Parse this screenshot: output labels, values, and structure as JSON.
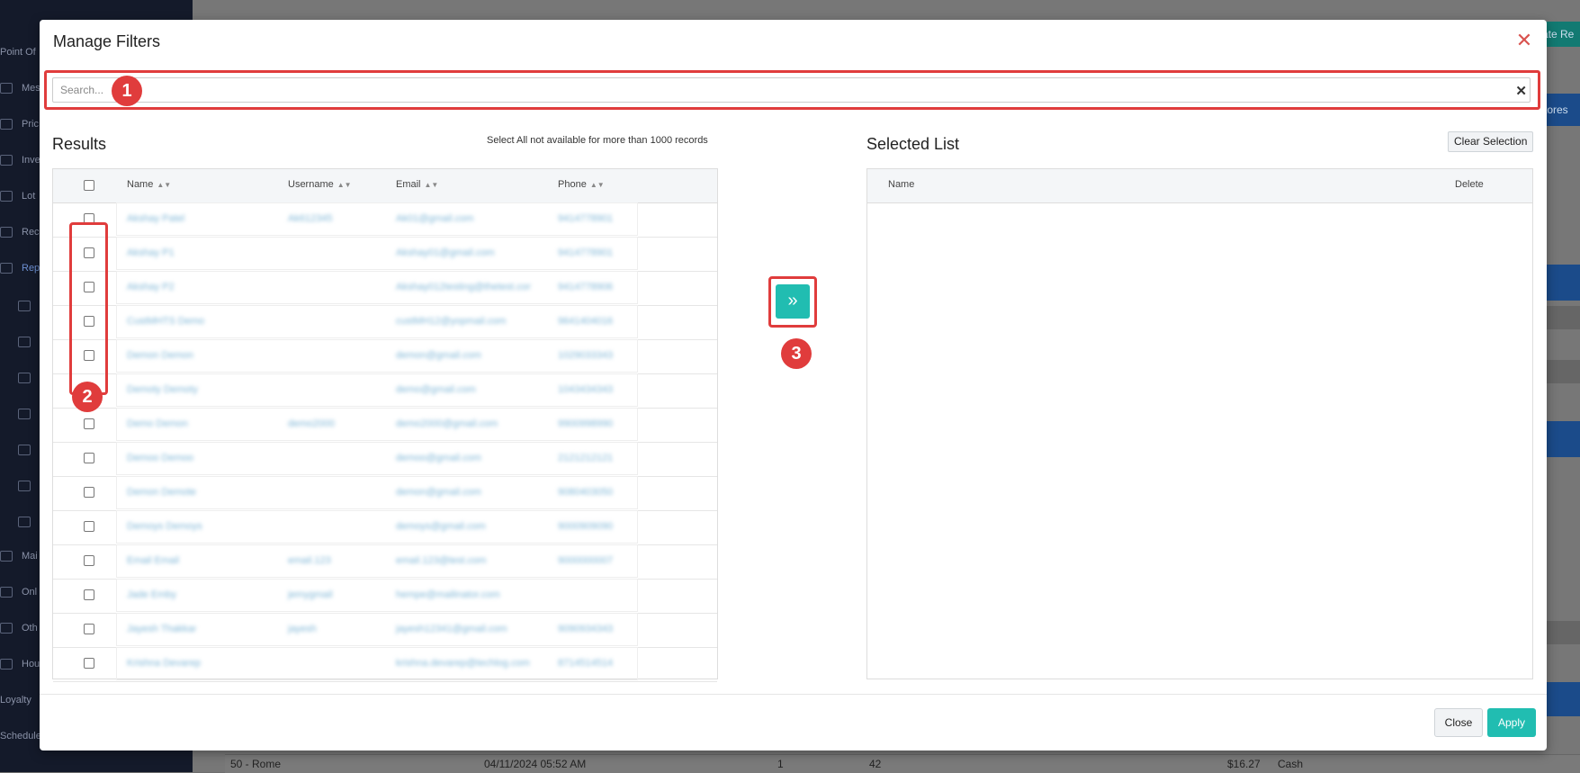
{
  "background": {
    "sidebar_items": [
      {
        "label": "Point Of",
        "icon": "none"
      },
      {
        "label": "Mes",
        "icon": "message-icon"
      },
      {
        "label": "Pric",
        "icon": "tag-icon"
      },
      {
        "label": "Inve",
        "icon": "inventory-icon"
      },
      {
        "label": "Lot",
        "icon": "lot-icon"
      },
      {
        "label": "Rec",
        "icon": "grid-icon"
      },
      {
        "label": "Rep",
        "icon": "chart-icon"
      },
      {
        "label": "Mai",
        "icon": "wrench-icon"
      },
      {
        "label": "Onl",
        "icon": "bag-icon"
      },
      {
        "label": "Oth",
        "icon": "gears-icon"
      },
      {
        "label": "Hou",
        "icon": "house-icon"
      },
      {
        "label": "Loyalty",
        "icon": "none"
      },
      {
        "label": "Schedule",
        "icon": "none"
      }
    ],
    "top_right_button": "ate Re",
    "right_bar_label": "tores",
    "bottom_row": {
      "store": "50 - Rome",
      "datetime": "04/11/2024 05:52 AM",
      "qty": "1",
      "num": "42",
      "amount": "$16.27",
      "payment": "Cash"
    }
  },
  "modal": {
    "title": "Manage Filters",
    "search": {
      "placeholder": "Search...",
      "value": ""
    },
    "callouts": [
      "1",
      "2",
      "3"
    ],
    "results": {
      "title": "Results",
      "note": "Select All not available for more than 1000 records",
      "columns": [
        "Name",
        "Username",
        "Email",
        "Phone"
      ],
      "rows": [
        {
          "name": "Akshay Patel",
          "username": "Ak612345",
          "email": "Ak01@gmail.com",
          "phone": "9414778901"
        },
        {
          "name": "Akshay P1",
          "username": "",
          "email": "Akshay01@gmail.com",
          "phone": "9414778901"
        },
        {
          "name": "Akshay P2",
          "username": "",
          "email": "Akshay012testing@thetest.com",
          "phone": "9414778906"
        },
        {
          "name": "CustMHTS Demo",
          "username": "",
          "email": "custMH12@yopmail.com",
          "phone": "9641404016"
        },
        {
          "name": "Demon Demon",
          "username": "",
          "email": "demon@gmail.com",
          "phone": "1029033343"
        },
        {
          "name": "Demoty Demoty",
          "username": "",
          "email": "demo@gmail.com",
          "phone": "1043434343"
        },
        {
          "name": "Demo Demon",
          "username": "demo2000",
          "email": "demo2000@gmail.com",
          "phone": "9900998990"
        },
        {
          "name": "Demoo Demoo",
          "username": "",
          "email": "demoo@gmail.com",
          "phone": "2121212121"
        },
        {
          "name": "Demon Demote",
          "username": "",
          "email": "demon@gmail.com",
          "phone": "9080403050"
        },
        {
          "name": "Demoys Demoys",
          "username": "",
          "email": "demoys@gmail.com",
          "phone": "9000909090"
        },
        {
          "name": "Email Email",
          "username": "email.123",
          "email": "email.123@test.com",
          "phone": "9000000007"
        },
        {
          "name": "Jade Emby",
          "username": "jemygmail",
          "email": "hempe@mailinator.com",
          "phone": ""
        },
        {
          "name": "Jayesh Thakkar",
          "username": "jayesh",
          "email": "jayesh12341@gmail.com",
          "phone": "9090934343"
        },
        {
          "name": "Krishna Devarep",
          "username": "",
          "email": "krishna.devarep@techlog.com",
          "phone": "8714514514"
        }
      ]
    },
    "move_button_glyph": "»",
    "selected": {
      "title": "Selected List",
      "clear_label": "Clear Selection",
      "columns": [
        "Name",
        "Delete"
      ]
    },
    "footer": {
      "close_label": "Close",
      "apply_label": "Apply"
    },
    "colors": {
      "accent": "#21bdb1",
      "callout": "#e03c3c",
      "close_x": "#d9534f"
    }
  }
}
